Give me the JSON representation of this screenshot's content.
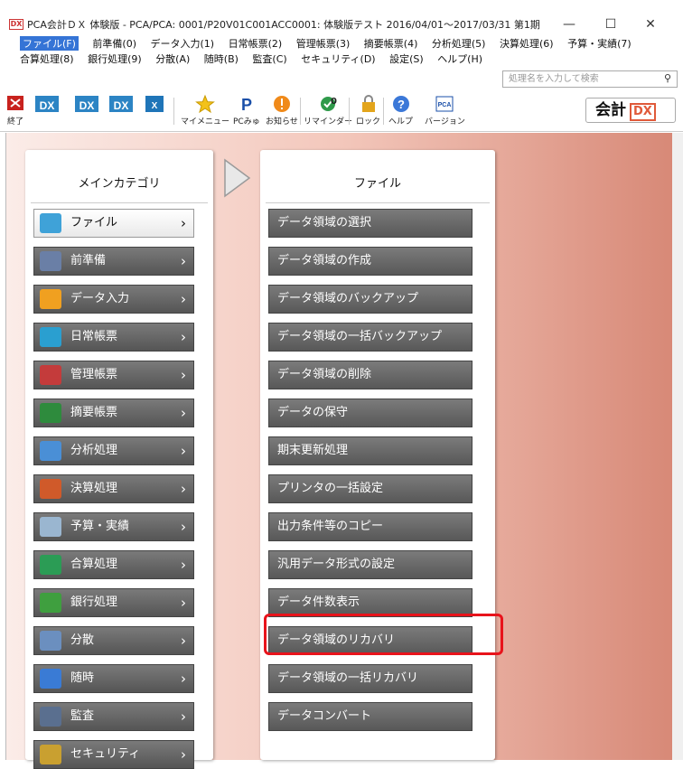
{
  "window": {
    "title": "PCA会計ＤＸ 体験版 - PCA/PCA: 0001/P20V01C001ACC0001: 体験版テスト 2016/04/01～2017/03/31 第1期",
    "logo": "DX",
    "minimize": "—",
    "maximize": "☐",
    "close": "✕"
  },
  "menu": {
    "row1": [
      "ファイル(F)",
      "前準備(0)",
      "データ入力(1)",
      "日常帳票(2)",
      "管理帳票(3)",
      "摘要帳票(4)",
      "分析処理(5)",
      "決算処理(6)",
      "予算・実績(7)"
    ],
    "row2": [
      "合算処理(8)",
      "銀行処理(9)",
      "分散(A)",
      "随時(B)",
      "監査(C)",
      "セキュリティ(D)",
      "設定(S)",
      "ヘルプ(H)"
    ]
  },
  "search": {
    "placeholder": "処理名を入力して検索"
  },
  "toolbar": {
    "items": [
      "終了",
      "マイメニュー",
      "PCみゅ",
      "お知らせ",
      "リマインダー",
      "ロック",
      "ヘルプ",
      "バージョン"
    ],
    "reminder_count": "0",
    "brand_text": "会計",
    "brand_dx": "DX"
  },
  "main_category": {
    "title": "メインカテゴリ",
    "items": [
      "ファイル",
      "前準備",
      "データ入力",
      "日常帳票",
      "管理帳票",
      "摘要帳票",
      "分析処理",
      "決算処理",
      "予算・実績",
      "合算処理",
      "銀行処理",
      "分散",
      "随時",
      "監査",
      "セキュリティ"
    ],
    "icon_colors": [
      "#3fa2d8",
      "#6a7fa6",
      "#f0a020",
      "#2a9fd0",
      "#c43b3b",
      "#2e8b3d",
      "#4a8fd6",
      "#d05a2a",
      "#9ab6d0",
      "#2b9c55",
      "#3f9f3f",
      "#6b8fbf",
      "#3a7bd5",
      "#5a6f8f",
      "#c9a030"
    ]
  },
  "file_panel": {
    "title": "ファイル",
    "items": [
      "データ領域の選択",
      "データ領域の作成",
      "データ領域のバックアップ",
      "データ領域の一括バックアップ",
      "データ領域の削除",
      "データの保守",
      "期末更新処理",
      "プリンタの一括設定",
      "出力条件等のコピー",
      "汎用データ形式の設定",
      "データ件数表示",
      "データ領域のリカバリ",
      "データ領域の一括リカバリ",
      "データコンバート"
    ]
  }
}
